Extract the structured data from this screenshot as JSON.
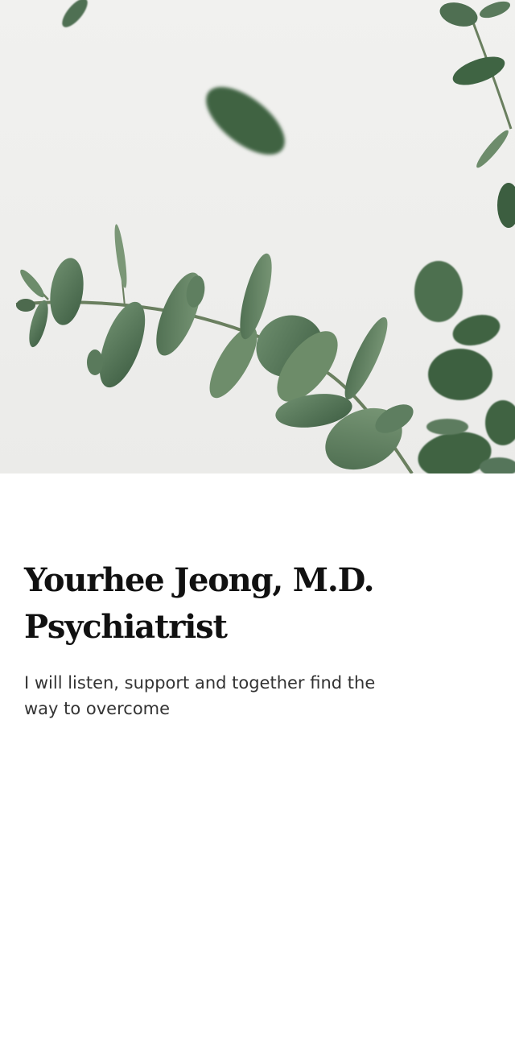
{
  "profile": {
    "name": "Yourhee Jeong, M.D.",
    "title": "Psychiatrist",
    "tagline": "I will listen, support and together find the way to overcome"
  },
  "hero": {
    "image_icon": "eucalyptus-branch-icon",
    "background_color": "#eeeeec",
    "leaf_color": "#5a7a5c"
  }
}
